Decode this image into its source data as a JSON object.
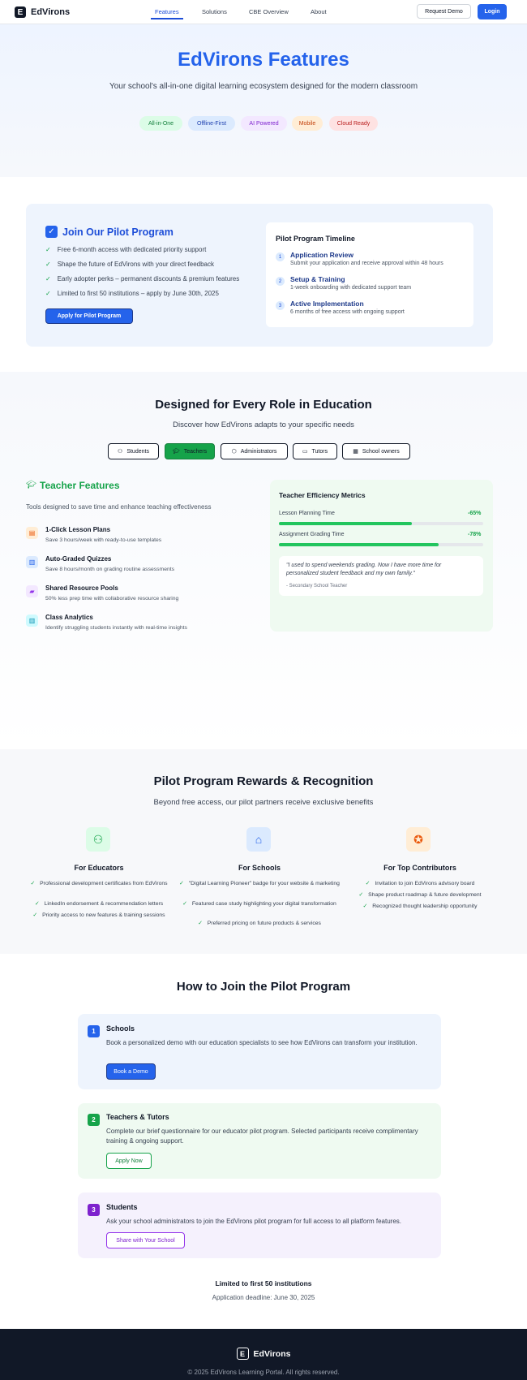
{
  "nav": {
    "logo_mark": "E",
    "brand": "EdVirons",
    "links": [
      "Features",
      "Solutions",
      "CBE Overview",
      "About"
    ],
    "request_demo": "Request Demo",
    "login": "Login"
  },
  "hero": {
    "title": "EdVirons Features",
    "subtitle": "Your school's all-in-one digital learning ecosystem designed for the modern classroom",
    "tags": [
      "All-in-One",
      "Offline-First",
      "AI Powered",
      "Mobile",
      "Cloud Ready"
    ]
  },
  "pilot": {
    "title": "Join Our Pilot Program",
    "items": [
      "Free 6-month access with dedicated priority support",
      "Shape the future of EdVirons with your direct feedback",
      "Early adopter perks – permanent discounts & premium features",
      "Limited to first 50 institutions – apply by June 30th, 2025"
    ],
    "apply_button": "Apply for Pilot Program",
    "timeline": {
      "title": "Pilot Program Timeline",
      "steps": [
        {
          "num": "1",
          "title": "Application Review",
          "desc": "Submit your application and receive approval within 48 hours"
        },
        {
          "num": "2",
          "title": "Setup & Training",
          "desc": "1-week onboarding with dedicated support team"
        },
        {
          "num": "3",
          "title": "Active Implementation",
          "desc": "6 months of free access with ongoing support"
        }
      ]
    }
  },
  "roles": {
    "title": "Designed for Every Role in Education",
    "subtitle": "Discover how EdVirons adapts to your specific needs",
    "tabs": [
      "Students",
      "Teachers",
      "Administrators",
      "Tutors",
      "School owners"
    ],
    "selected_tab": "Teachers",
    "teacher": {
      "title": "Teacher Features",
      "subtitle": "Tools designed to save time and enhance teaching effectiveness",
      "features": [
        {
          "title": "1-Click Lesson Plans",
          "desc": "Save 3 hours/week with ready-to-use templates"
        },
        {
          "title": "Auto-Graded Quizzes",
          "desc": "Save 8 hours/month on grading routine assessments"
        },
        {
          "title": "Shared Resource Pools",
          "desc": "50% less prep time with collaborative resource sharing"
        },
        {
          "title": "Class Analytics",
          "desc": "Identify struggling students instantly with real-time insights"
        }
      ]
    },
    "metrics": {
      "title": "Teacher Efficiency Metrics",
      "rows": [
        {
          "label": "Lesson Planning Time",
          "value": "-65%",
          "fill": 0.65
        },
        {
          "label": "Assignment Grading Time",
          "value": "-78%",
          "fill": 0.78
        }
      ],
      "quote": "\"I used to spend weekends grading. Now I have more time for personalized student feedback and my own family.\"",
      "quote_by": "- Secondary School Teacher"
    }
  },
  "rewards": {
    "title": "Pilot Program Rewards & Recognition",
    "subtitle": "Beyond free access, our pilot partners receive exclusive benefits",
    "columns": [
      {
        "icon": "users-icon",
        "title": "For Educators",
        "items": [
          "Professional development certificates from EdVirons",
          "LinkedIn endorsement & recommendation letters",
          "Priority access to new features & training sessions"
        ]
      },
      {
        "icon": "school-icon",
        "title": "For Schools",
        "items": [
          "\"Digital Learning Pioneer\" badge for your website & marketing",
          "Featured case study highlighting your digital transformation",
          "Preferred pricing on future products & services"
        ]
      },
      {
        "icon": "award-icon",
        "title": "For Top Contributors",
        "items": [
          "Invitation to join EdVirons advisory board",
          "Shape product roadmap & future development",
          "Recognized thought leadership opportunity"
        ]
      }
    ]
  },
  "join": {
    "title": "How to Join the Pilot Program",
    "steps": [
      {
        "num": "1",
        "title": "Schools",
        "desc": "Book a personalized demo with our education specialists to see how EdVirons can transform your institution.",
        "button": "Book a Demo"
      },
      {
        "num": "2",
        "title": "Teachers & Tutors",
        "desc": "Complete our brief questionnaire for our educator pilot program. Selected participants receive complimentary training & ongoing support.",
        "button": "Apply Now"
      },
      {
        "num": "3",
        "title": "Students",
        "desc": "Ask your school administrators to join the EdVirons pilot program for full access to all platform features.",
        "button": "Share with Your School"
      }
    ],
    "limit": "Limited to first 50 institutions",
    "deadline": "Application deadline: June 30, 2025"
  },
  "footer": {
    "logo_mark": "E",
    "brand": "EdVirons",
    "copyright": "© 2025 EdVirons Learning Portal. All rights reserved."
  },
  "colors": {
    "primary": "#2563eb",
    "green": "#16a34a",
    "footer": "#111827"
  }
}
